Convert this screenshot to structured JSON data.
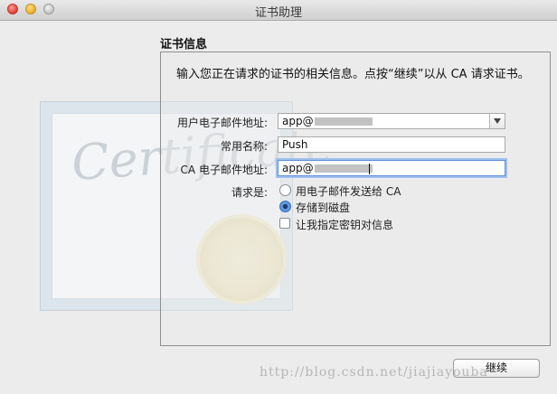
{
  "window": {
    "title": "证书助理"
  },
  "section": {
    "title": "证书信息",
    "intro": "输入您正在请求的证书的相关信息。点按“继续”以从 CA 请求证书。"
  },
  "artwork": {
    "script_text": "Certificate"
  },
  "form": {
    "user_email_label": "用户电子邮件地址:",
    "user_email_value": "app@",
    "common_name_label": "常用名称:",
    "common_name_value": "Push",
    "ca_email_label": "CA 电子邮件地址:",
    "ca_email_value": "app@",
    "request_label": "请求是:",
    "option_email_ca": "用电子邮件发送给 CA",
    "option_save_disk": "存储到磁盘",
    "option_custom_key": "让我指定密钥对信息",
    "selected_option": "存储到磁盘"
  },
  "buttons": {
    "continue": "继续"
  },
  "watermark": "http://blog.csdn.net/jiajiayouba",
  "colors": {
    "focus_ring": "#9ec1ee",
    "radio_selected": "#4a86d4"
  }
}
